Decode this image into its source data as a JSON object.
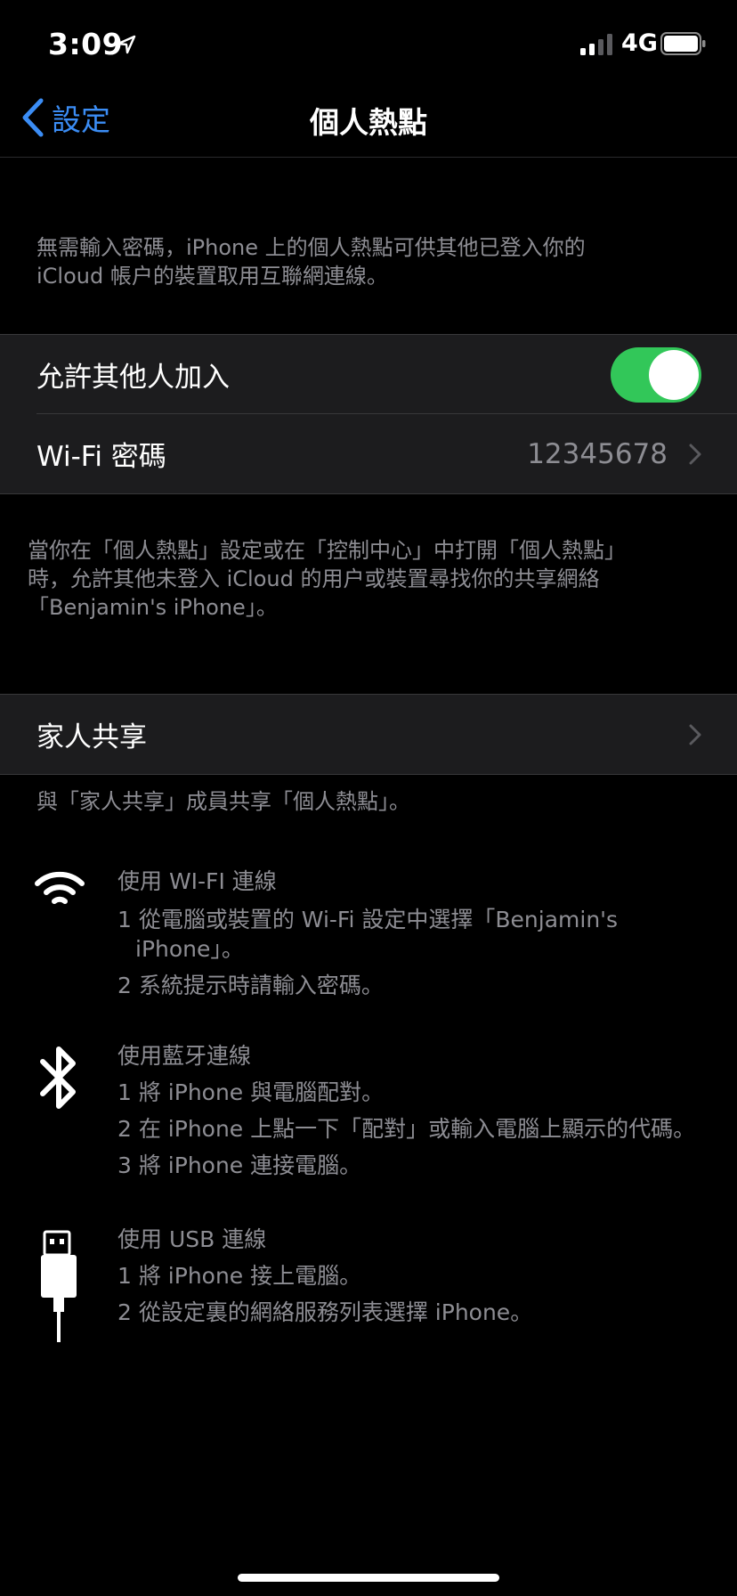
{
  "status_bar": {
    "time": "3:09",
    "network": "4G"
  },
  "nav": {
    "back_label": "設定",
    "title": "個人熱點"
  },
  "intro_note": [
    "無需輸入密碼，iPhone 上的個人熱點可供其他已登入你的",
    "iCloud 帳户的裝置取用互聯網連線。"
  ],
  "settings": {
    "allow_others_label": "允許其他人加入",
    "allow_others_on": true,
    "wifi_password_label": "Wi-Fi 密碼",
    "wifi_password_value": "12345678"
  },
  "discover_note": [
    "當你在「個人熱點」設定或在「控制中心」中打開「個人熱點」",
    "時，允許其他未登入 iCloud 的用户或裝置尋找你的共享網絡",
    "「Benjamin's iPhone」。"
  ],
  "family": {
    "label": "家人共享",
    "note": "與「家人共享」成員共享「個人熱點」。"
  },
  "instructions": {
    "wifi": {
      "icon": "wifi-icon",
      "title": "使用 WI-FI 連線",
      "steps": [
        "1 從電腦或裝置的 Wi-Fi 設定中選擇「Benjamin's",
        "iPhone」。",
        "2 系統提示時請輸入密碼。"
      ]
    },
    "bluetooth": {
      "icon": "bluetooth-icon",
      "title": "使用藍牙連線",
      "steps": [
        "1 將 iPhone 與電腦配對。",
        "2 在 iPhone 上點一下「配對」或輸入電腦上顯示的代碼。",
        "3 將 iPhone 連接電腦。"
      ]
    },
    "usb": {
      "icon": "usb-cable-icon",
      "title": "使用 USB 連線",
      "steps": [
        "1 將 iPhone 接上電腦。",
        "2 從設定裏的網絡服務列表選擇 iPhone。"
      ]
    }
  },
  "colors": {
    "accent": "#3b8df5",
    "toggle_on": "#32c759",
    "cell_bg": "#1c1c1e",
    "note_text": "#8d8d93"
  }
}
